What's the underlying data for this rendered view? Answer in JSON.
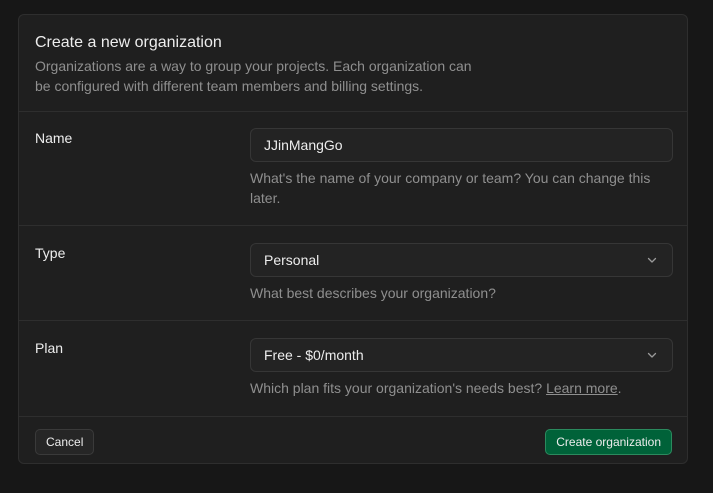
{
  "dialog": {
    "title": "Create a new organization",
    "description": "Organizations are a way to group your projects. Each organization can be configured with different team members and billing settings."
  },
  "name_field": {
    "label": "Name",
    "value": "JJinMangGo",
    "hint": "What's the name of your company or team? You can change this later."
  },
  "type_field": {
    "label": "Type",
    "value": "Personal",
    "hint": "What best describes your organization?"
  },
  "plan_field": {
    "label": "Plan",
    "value": "Free - $0/month",
    "hint": "Which plan fits your organization's needs best?",
    "learn_more": "Learn more",
    "hint_suffix": "."
  },
  "footer": {
    "cancel_label": "Cancel",
    "create_label": "Create organization"
  },
  "icons": {
    "select_chevron": "chevron-down-icon"
  },
  "colors": {
    "background": "#171717",
    "panel": "#1f1f1f",
    "primary_button": "#006239",
    "text": "#ededed",
    "muted_text": "#8f8f8f"
  }
}
